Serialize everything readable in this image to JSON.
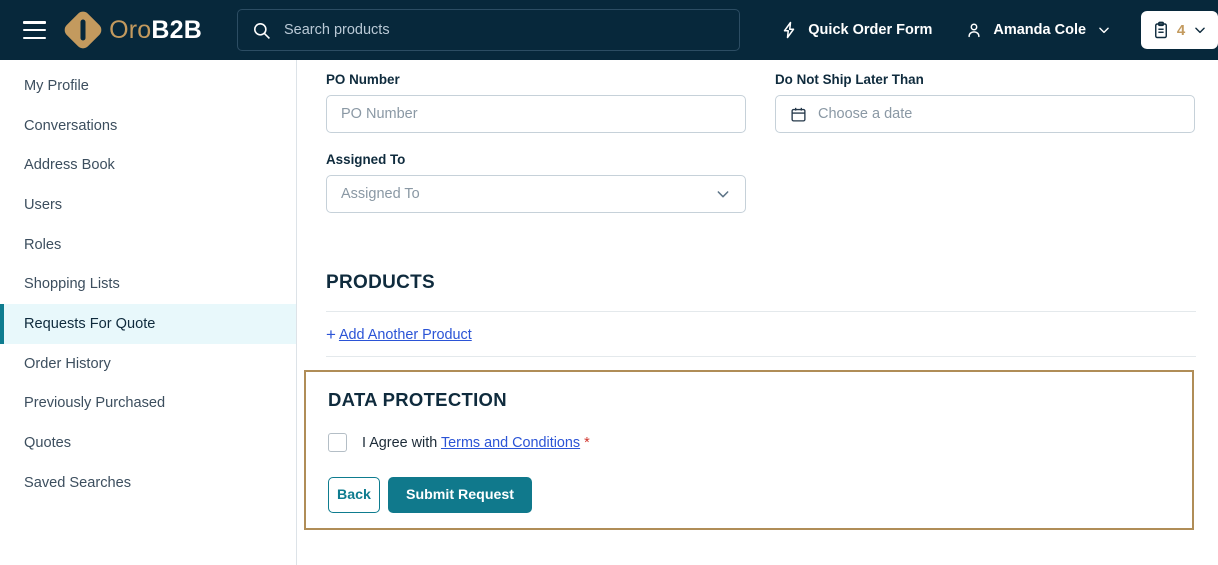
{
  "header": {
    "menu_icon": "hamburger-menu-icon",
    "logo": {
      "part1": "Oro",
      "part2": "B2B"
    },
    "search": {
      "placeholder": "Search products",
      "icon": "search-icon"
    },
    "quick_order": {
      "label": "Quick Order Form",
      "icon": "lightning-bolt-icon"
    },
    "account": {
      "label": "Amanda Cole",
      "icon": "user-icon",
      "chevron": "chevron-down-icon"
    },
    "cart": {
      "count": "4",
      "icon": "clipboard-icon",
      "chevron": "chevron-down-icon"
    }
  },
  "sidebar": {
    "items": [
      {
        "label": "My Profile",
        "active": false
      },
      {
        "label": "Conversations",
        "active": false
      },
      {
        "label": "Address Book",
        "active": false
      },
      {
        "label": "Users",
        "active": false
      },
      {
        "label": "Roles",
        "active": false
      },
      {
        "label": "Shopping Lists",
        "active": false
      },
      {
        "label": "Requests For Quote",
        "active": true
      },
      {
        "label": "Order History",
        "active": false
      },
      {
        "label": "Previously Purchased",
        "active": false
      },
      {
        "label": "Quotes",
        "active": false
      },
      {
        "label": "Saved Searches",
        "active": false
      }
    ]
  },
  "form": {
    "po_number": {
      "label": "PO Number",
      "placeholder": "PO Number",
      "value": ""
    },
    "ship_later": {
      "label": "Do Not Ship Later Than",
      "placeholder": "Choose a date",
      "value": "",
      "icon": "calendar-icon"
    },
    "assigned_to": {
      "label": "Assigned To",
      "placeholder": "Assigned To",
      "value": "",
      "chevron": "chevron-down-icon"
    }
  },
  "products": {
    "title": "PRODUCTS",
    "add_another": "Add Another Product",
    "plus": "+"
  },
  "data_protection": {
    "title": "DATA PROTECTION",
    "agree_prefix": "I Agree with",
    "terms_link": "Terms and Conditions",
    "required_marker": "*",
    "back_label": "Back",
    "submit_label": "Submit Request"
  },
  "colors": {
    "header_bg": "#07283B",
    "brand_gold": "#C39A5E",
    "teal": "#10798C",
    "active_sidebar_bg": "#E8F8FB",
    "panel_border": "#B08D57",
    "link_blue": "#2B54D6",
    "required_red": "#D0342C"
  }
}
